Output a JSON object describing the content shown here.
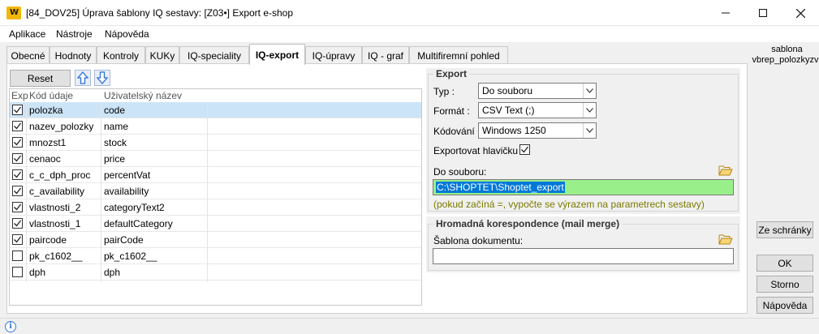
{
  "window": {
    "title": "[84_DOV25] Úprava šablony IQ sestavy: [Z03•] Export e-shop",
    "logo_text": "W"
  },
  "menu": [
    "Aplikace",
    "Nástroje",
    "Nápověda"
  ],
  "tabs": [
    {
      "label": "Obecné",
      "active": false
    },
    {
      "label": "Hodnoty",
      "active": false
    },
    {
      "label": "Kontroly",
      "active": false
    },
    {
      "label": "KUKy",
      "active": false
    },
    {
      "label": "IQ-speciality",
      "active": false
    },
    {
      "label": "IQ-export",
      "active": true
    },
    {
      "label": "IQ-úpravy",
      "active": false
    },
    {
      "label": "IQ - graf",
      "active": false
    },
    {
      "label": "Multifiremní pohled",
      "active": false
    }
  ],
  "toolbar": {
    "reset_label": "Reset",
    "up_icon": "arrow-up-icon",
    "down_icon": "arrow-down-icon"
  },
  "grid": {
    "columns": [
      "Exp",
      "Kód údaje",
      "Uživatelský název"
    ],
    "rows": [
      {
        "exp": true,
        "code": "polozka",
        "name": "code",
        "selected": true
      },
      {
        "exp": true,
        "code": "nazev_polozky",
        "name": "name",
        "selected": false
      },
      {
        "exp": true,
        "code": "mnozst1",
        "name": "stock",
        "selected": false
      },
      {
        "exp": true,
        "code": "cenaoc",
        "name": "price",
        "selected": false
      },
      {
        "exp": true,
        "code": "c_c_dph_proc",
        "name": "percentVat",
        "selected": false
      },
      {
        "exp": true,
        "code": "c_availability",
        "name": "availability",
        "selected": false
      },
      {
        "exp": true,
        "code": "vlastnosti_2",
        "name": "categoryText2",
        "selected": false
      },
      {
        "exp": true,
        "code": "vlastnosti_1",
        "name": "defaultCategory",
        "selected": false
      },
      {
        "exp": true,
        "code": "paircode",
        "name": "pairCode",
        "selected": false
      },
      {
        "exp": false,
        "code": "pk_c1602__",
        "name": "pk_c1602__",
        "selected": false
      },
      {
        "exp": false,
        "code": "dph",
        "name": "dph",
        "selected": false
      }
    ]
  },
  "export": {
    "group_title": "Export",
    "type_label": "Typ :",
    "type_value": "Do souboru",
    "format_label": "Formát :",
    "format_value": "CSV Text (;)",
    "encoding_label": "Kódování :",
    "encoding_value": "Windows 1250",
    "header_label": "Exportovat hlavičku :",
    "header_checked": true,
    "file_label": "Do souboru:",
    "file_value": "C:\\SHOPTET\\Shoptet_export",
    "hint": "(pokud začíná =, vypočte se výrazem na parametrech sestavy)"
  },
  "mailmerge": {
    "group_title": "Hromadná korespondence (mail merge)",
    "template_label": "Šablona dokumentu:",
    "template_value": ""
  },
  "sidebar": {
    "label_line1": "sablona",
    "label_line2": "vbrep_polozkyzv",
    "clipboard_label": "Ze schránky",
    "ok_label": "OK",
    "cancel_label": "Storno",
    "help_label": "Nápověda"
  },
  "status": {
    "icon": "info-icon"
  },
  "colors": {
    "selection": "#cce4f7",
    "file_input_bg": "#99f08a",
    "text_selection": "#0078d7",
    "hint_text": "#7a7a00",
    "logo_bg": "#f2b705"
  }
}
